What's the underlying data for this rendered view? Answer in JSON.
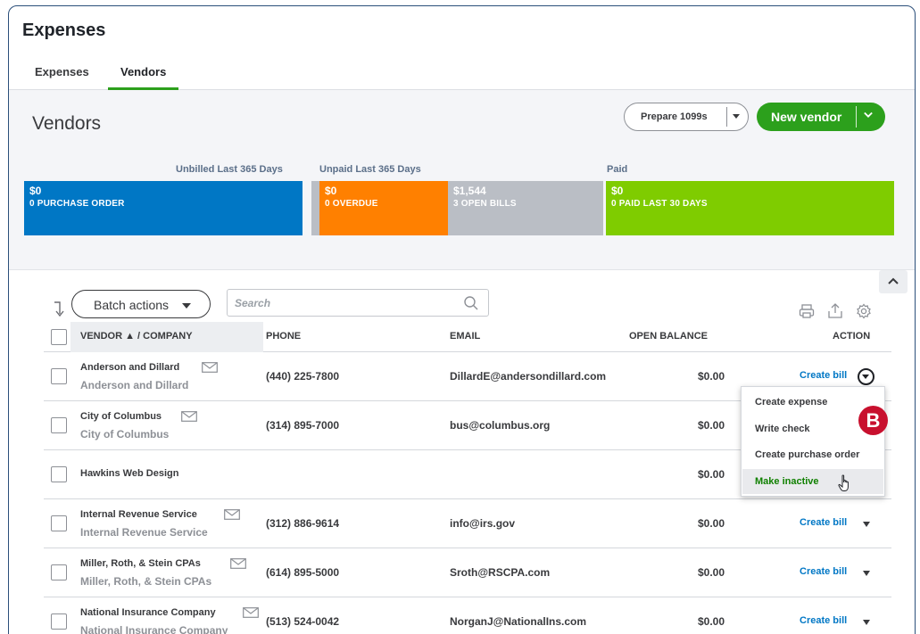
{
  "page": {
    "title": "Expenses"
  },
  "tabs": [
    {
      "label": "Expenses"
    },
    {
      "label": "Vendors"
    }
  ],
  "vendors_panel": {
    "heading": "Vendors",
    "prepare_button": "Prepare 1099s",
    "new_vendor_button": "New vendor"
  },
  "money_bar": {
    "labels": {
      "unbilled": "Unbilled Last 365 Days",
      "unpaid": "Unpaid Last 365 Days",
      "paid": "Paid"
    },
    "purchase_order": {
      "amount": "$0",
      "caption": "0 PURCHASE ORDER",
      "color": "#0077c5"
    },
    "overdue": {
      "amount": "$0",
      "caption": "0 OVERDUE",
      "color": "#ff8000"
    },
    "open_bills": {
      "amount": "$1,544",
      "caption": "3 OPEN BILLS",
      "color": "#babec5"
    },
    "paid": {
      "amount": "$0",
      "caption": "0 PAID LAST 30 DAYS",
      "color": "#7fcc00"
    }
  },
  "toolbar": {
    "batch_actions": "Batch actions",
    "search_placeholder": "Search",
    "icons": [
      "sort-icon",
      "search-icon",
      "print-icon",
      "export-icon",
      "settings-icon",
      "collapse-icon"
    ]
  },
  "table": {
    "headers": {
      "vendor": "VENDOR ▲ / COMPANY",
      "phone": "PHONE",
      "email": "EMAIL",
      "balance": "OPEN BALANCE",
      "action": "ACTION"
    },
    "rows": [
      {
        "vendor": "Anderson and Dillard",
        "company": "Anderson and Dillard",
        "phone": "(440) 225-7800",
        "email": "DillardE@andersondillard.com",
        "balance": "$0.00",
        "action": "Create bill"
      },
      {
        "vendor": "City of Columbus",
        "company": "City of Columbus",
        "phone": "(314) 895-7000",
        "email": "bus@columbus.org",
        "balance": "$0.00",
        "action": ""
      },
      {
        "vendor": "Hawkins Web Design",
        "company": "",
        "phone": "",
        "email": "",
        "balance": "$0.00",
        "action": ""
      },
      {
        "vendor": "Internal Revenue Service",
        "company": "Internal Revenue Service",
        "phone": "(312) 886-9614",
        "email": "info@irs.gov",
        "balance": "$0.00",
        "action": "Create bill"
      },
      {
        "vendor": "Miller, Roth, & Stein CPAs",
        "company": "Miller, Roth, & Stein CPAs",
        "phone": "(614) 895-5000",
        "email": "Sroth@RSCPA.com",
        "balance": "$0.00",
        "action": "Create bill"
      },
      {
        "vendor": "National Insurance Company",
        "company": "National Insurance Company",
        "phone": "(513) 524-0042",
        "email": "NorganJ@NationalIns.com",
        "balance": "$0.00",
        "action": "Create bill"
      }
    ]
  },
  "action_menu": {
    "items": [
      "Create expense",
      "Write check",
      "Create purchase order",
      "Make inactive"
    ],
    "highlighted": "Make inactive"
  },
  "callout": {
    "label": "B",
    "color": "#c8102e"
  },
  "colors": {
    "accent_green": "#2ca01c",
    "link_blue": "#0077c5"
  }
}
